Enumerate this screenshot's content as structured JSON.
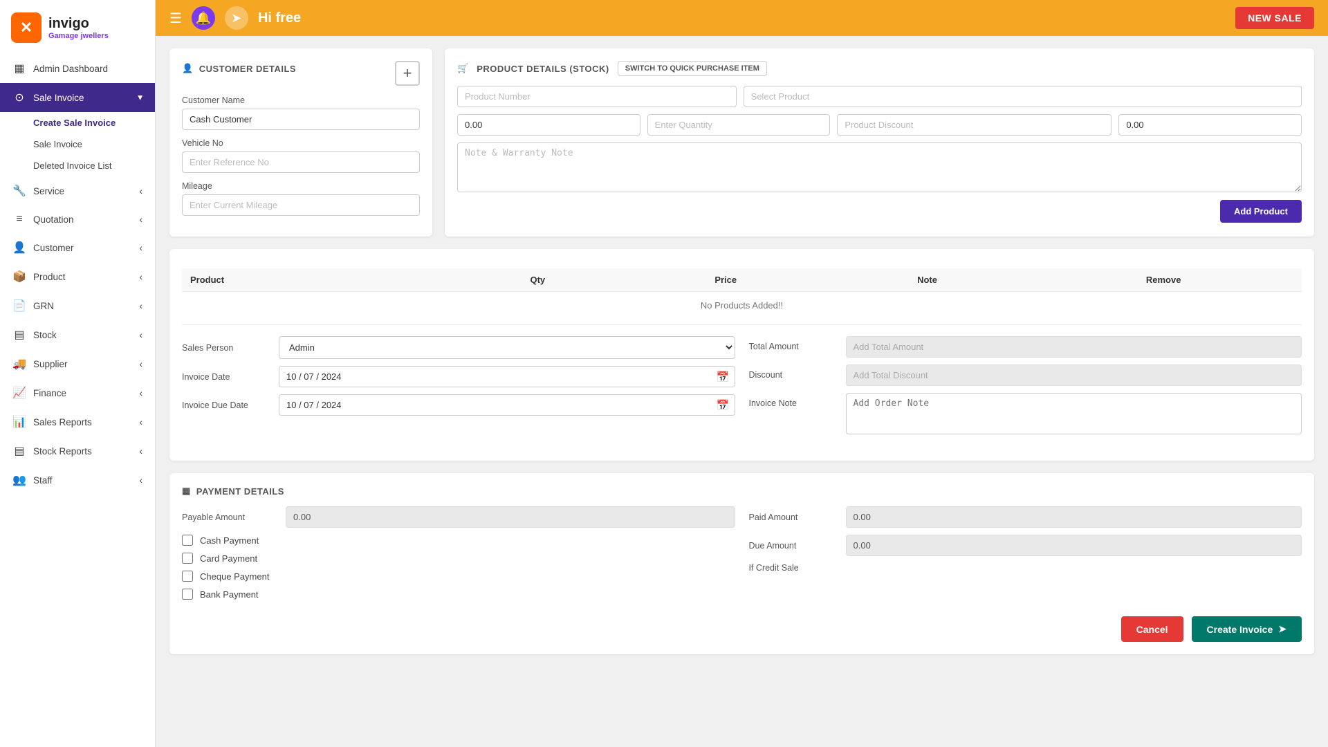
{
  "brand": {
    "logo_text": "✕",
    "name": "invigo",
    "sub": "Gamage jwellers"
  },
  "topbar": {
    "greeting": "Hi free",
    "new_sale_label": "NEW SALE"
  },
  "sidebar": {
    "items": [
      {
        "id": "admin-dashboard",
        "icon": "▦",
        "label": "Admin Dashboard",
        "active": false
      },
      {
        "id": "sale-invoice",
        "icon": "⊙",
        "label": "Sale Invoice",
        "active": true,
        "expanded": true
      },
      {
        "id": "create-sale-invoice",
        "label": "Create Sale Invoice",
        "active": true
      },
      {
        "id": "sale-invoice-sub",
        "label": "Sale Invoice",
        "active": false
      },
      {
        "id": "deleted-invoice-list",
        "label": "Deleted Invoice List",
        "active": false
      },
      {
        "id": "service",
        "icon": "🔧",
        "label": "Service",
        "active": false
      },
      {
        "id": "quotation",
        "icon": "≡",
        "label": "Quotation",
        "active": false
      },
      {
        "id": "customer",
        "icon": "👤",
        "label": "Customer",
        "active": false
      },
      {
        "id": "product",
        "icon": "📦",
        "label": "Product",
        "active": false
      },
      {
        "id": "grn",
        "icon": "📄",
        "label": "GRN",
        "active": false
      },
      {
        "id": "stock",
        "icon": "▤",
        "label": "Stock",
        "active": false
      },
      {
        "id": "supplier",
        "icon": "🚚",
        "label": "Supplier",
        "active": false
      },
      {
        "id": "finance",
        "icon": "📈",
        "label": "Finance",
        "active": false
      },
      {
        "id": "sales-reports",
        "icon": "📊",
        "label": "Sales Reports",
        "active": false
      },
      {
        "id": "stock-reports",
        "icon": "▤",
        "label": "Stock Reports",
        "active": false
      },
      {
        "id": "staff",
        "icon": "👥",
        "label": "Staff",
        "active": false
      }
    ]
  },
  "customer_details": {
    "section_title": "CUSTOMER DETAILS",
    "name_label": "Customer Name",
    "name_value": "Cash Customer",
    "name_placeholder": "Customer Name",
    "vehicle_label": "Vehicle No",
    "vehicle_placeholder": "Enter Reference No",
    "mileage_label": "Mileage",
    "mileage_placeholder": "Enter Current Mileage"
  },
  "product_details": {
    "section_title": "PRODUCT DETAILS (STOCK)",
    "quick_btn_label": "SWITCH TO QUICK PURCHASE ITEM",
    "product_number_placeholder": "Product Number",
    "select_product_placeholder": "Select Product",
    "price_value": "0.00",
    "quantity_placeholder": "Enter Quantity",
    "discount_placeholder": "Product Discount",
    "discount_value": "0.00",
    "note_placeholder": "Note & Warranty Note",
    "add_product_label": "Add Product",
    "table_headers": [
      "Product",
      "Qty",
      "Price",
      "Note",
      "Remove"
    ],
    "no_products_msg": "No Products Added!!"
  },
  "invoice_form": {
    "sales_person_label": "Sales Person",
    "sales_person_value": "Admin",
    "invoice_date_label": "Invoice Date",
    "invoice_date_value": "10 / 07 / 2024",
    "invoice_due_date_label": "Invoice Due Date",
    "invoice_due_date_value": "10 / 07 / 2024",
    "total_amount_label": "Total Amount",
    "total_amount_placeholder": "Add Total Amount",
    "discount_label": "Discount",
    "discount_placeholder": "Add Total Discount",
    "invoice_note_label": "Invoice Note",
    "invoice_note_placeholder": "Add Order Note"
  },
  "payment_details": {
    "section_title": "PAYMENT DETAILS",
    "payable_amount_label": "Payable Amount",
    "payable_amount_value": "0.00",
    "cash_payment_label": "Cash Payment",
    "card_payment_label": "Card Payment",
    "cheque_payment_label": "Cheque Payment",
    "bank_payment_label": "Bank Payment",
    "paid_amount_label": "Paid Amount",
    "paid_amount_value": "0.00",
    "due_amount_label": "Due Amount",
    "due_amount_value": "0.00",
    "if_credit_label": "If Credit Sale"
  },
  "actions": {
    "cancel_label": "Cancel",
    "create_label": "Create Invoice"
  }
}
